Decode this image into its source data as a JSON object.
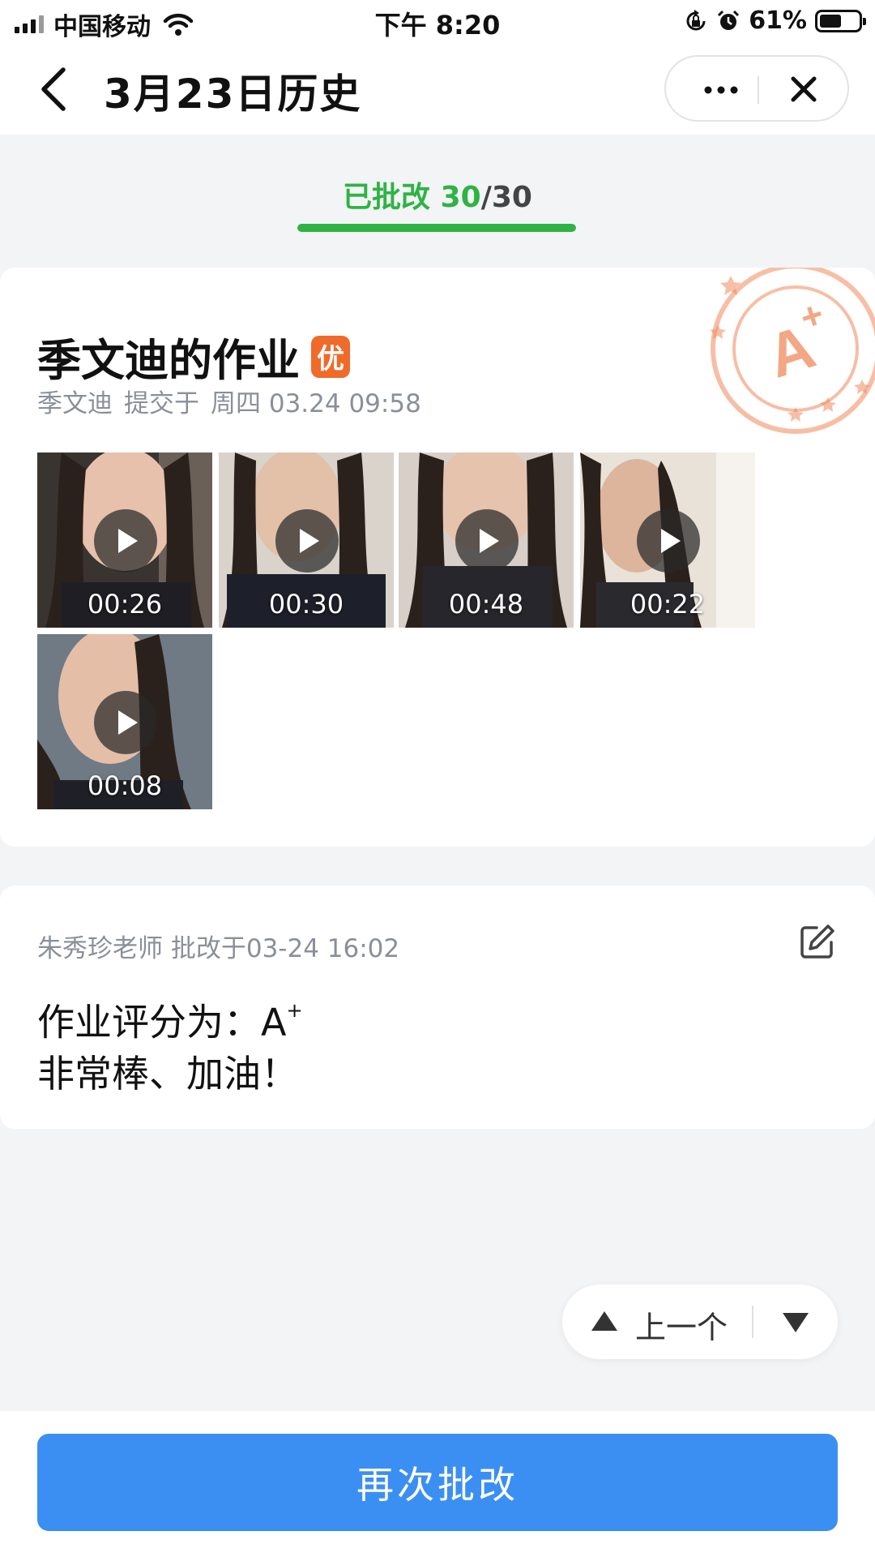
{
  "status_bar": {
    "carrier": "中国移动",
    "time": "下午 8:20",
    "battery_percent": "61%",
    "battery_level": 0.61,
    "icons": [
      "signal-icon",
      "wifi-icon",
      "rotation-lock-icon",
      "alarm-icon",
      "battery-icon"
    ]
  },
  "nav": {
    "title": "3月23日历史",
    "icons": [
      "back-icon",
      "more-icon",
      "close-icon"
    ]
  },
  "progress": {
    "label": "已批改 ",
    "done": "30",
    "separator": "/",
    "total": "30",
    "fraction": 1.0,
    "color": "#2fb344"
  },
  "homework": {
    "title": "季文迪的作业",
    "badge": "优",
    "student": "季文迪",
    "submitted_label": "提交于",
    "submitted_time": "周四 03.24 09:58",
    "stamp": {
      "grade": "A",
      "plus": "+"
    },
    "videos": [
      {
        "duration": "00:26"
      },
      {
        "duration": "00:30"
      },
      {
        "duration": "00:48"
      },
      {
        "duration": "00:22"
      },
      {
        "duration": "00:08"
      }
    ]
  },
  "comment": {
    "teacher": "朱秀珍老师",
    "graded_label": "批改于",
    "graded_time": "03-24 16:02",
    "score_line_prefix": "作业评分为：",
    "score_grade": "A",
    "score_plus": "+",
    "remark": "非常棒、加油！"
  },
  "pager": {
    "prev_label": "上一个"
  },
  "action": {
    "button_label": "再次批改",
    "color": "#3b8ff2"
  }
}
